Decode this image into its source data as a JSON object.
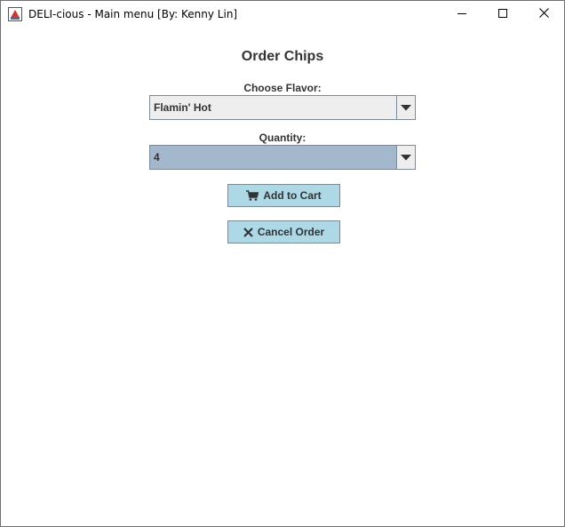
{
  "window": {
    "title": "DELI-cious - Main menu [By: Kenny Lin]",
    "controls": [
      "minimize-icon",
      "maximize-icon",
      "close-icon"
    ]
  },
  "form": {
    "heading": "Order Chips",
    "flavor": {
      "label": "Choose Flavor:",
      "selected": "Flamin' Hot"
    },
    "quantity": {
      "label": "Quantity:",
      "selected": "4"
    },
    "add_button": {
      "label": "Add to Cart",
      "icon": "cart-icon"
    },
    "cancel_button": {
      "label": "Cancel Order",
      "icon": "x-icon"
    }
  },
  "colors": {
    "button_bg": "#add8e6",
    "combo_selected_bg": "#a3b8cc",
    "combo_bg": "#eeeeee",
    "text": "#333333"
  }
}
